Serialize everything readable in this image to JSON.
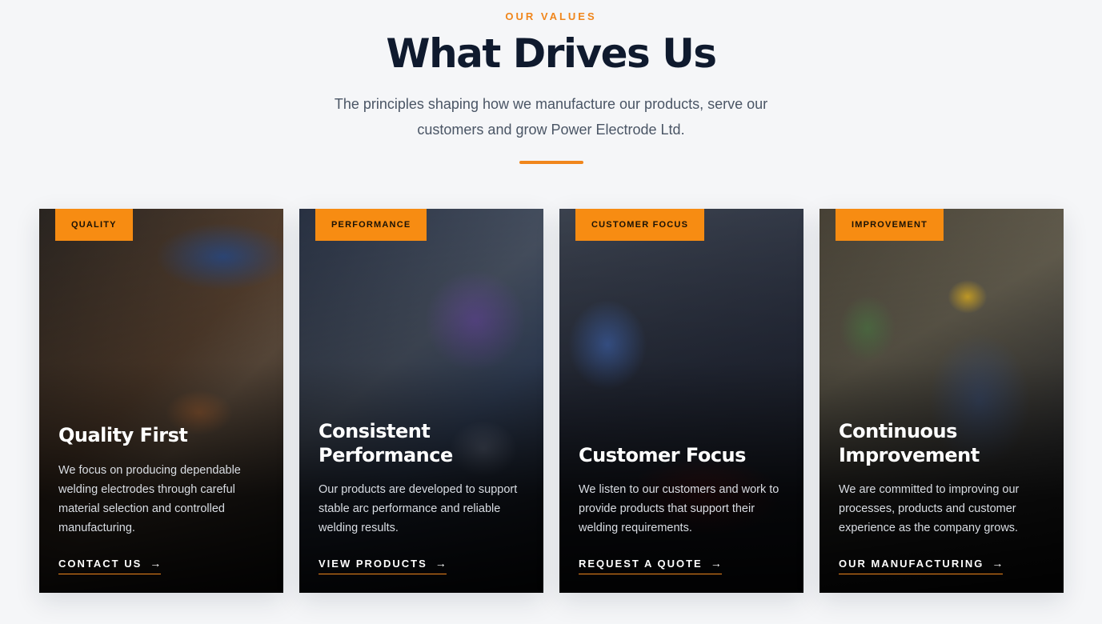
{
  "section": {
    "eyebrow": "OUR VALUES",
    "title": "What Drives Us",
    "subtitle": "The principles shaping how we manufacture our products, serve our customers and grow Power Electrode Ltd."
  },
  "colors": {
    "accent": "#f78c12",
    "heading": "#0f1a2e",
    "background": "#f5f6f8"
  },
  "cards": [
    {
      "tag": "QUALITY",
      "title": "Quality First",
      "text": "We focus on producing dependable welding electrodes through careful material selection and controlled manufacturing.",
      "link": "CONTACT US",
      "arrow_icon": "arrow-right-icon"
    },
    {
      "tag": "PERFORMANCE",
      "title": "Consistent Performance",
      "text": "Our products are developed to support stable arc performance and reliable welding results.",
      "link": "VIEW PRODUCTS",
      "arrow_icon": "arrow-right-icon"
    },
    {
      "tag": "CUSTOMER FOCUS",
      "title": "Customer Focus",
      "text": "We listen to our customers and work to provide products that support their welding requirements.",
      "link": "REQUEST A QUOTE",
      "arrow_icon": "arrow-right-icon"
    },
    {
      "tag": "IMPROVEMENT",
      "title": "Continuous Improvement",
      "text": "We are committed to improving our processes, products and customer experience as the company grows.",
      "link": "OUR MANUFACTURING",
      "arrow_icon": "arrow-right-icon"
    }
  ]
}
